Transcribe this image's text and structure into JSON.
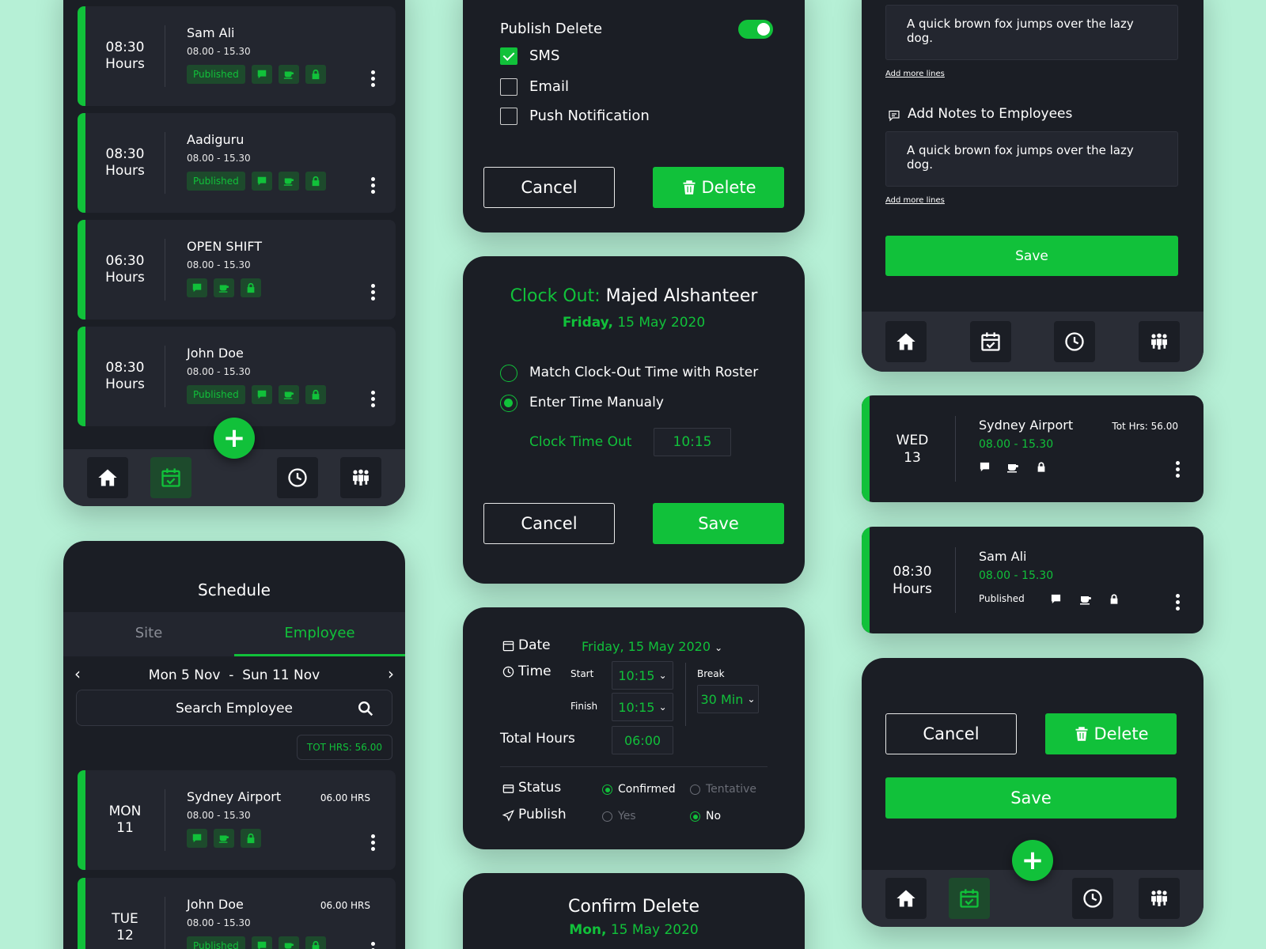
{
  "colors": {
    "accent": "#11c13a",
    "panel": "#1b1e25",
    "card": "#23262f",
    "background": "#b6f0d6"
  },
  "icons": [
    "chat-icon",
    "coffee-icon",
    "lock-icon",
    "home-icon",
    "calendar-check-icon",
    "clock-icon",
    "team-icon",
    "trash-icon",
    "search-icon",
    "calendar-icon",
    "status-icon",
    "send-icon",
    "note-icon",
    "plus-icon",
    "chevron-down-icon"
  ],
  "roster": {
    "shifts": [
      {
        "hours_value": "08:30",
        "hours_label": "Hours",
        "name": "Sam Ali",
        "time": "08.00 - 15.30",
        "badge": "Published"
      },
      {
        "hours_value": "08:30",
        "hours_label": "Hours",
        "name": "Aadiguru",
        "time": "08.00 - 15.30",
        "badge": "Published"
      },
      {
        "hours_value": "06:30",
        "hours_label": "Hours",
        "name": "OPEN SHIFT",
        "time": "08.00 - 15.30",
        "badge": ""
      },
      {
        "hours_value": "08:30",
        "hours_label": "Hours",
        "name": "John Doe",
        "time": "08.00 - 15.30",
        "badge": "Published"
      }
    ],
    "fab": "+"
  },
  "schedule": {
    "title": "Schedule",
    "tabs": [
      "Site",
      "Employee"
    ],
    "active_tab": "Employee",
    "range_start": "Mon 5 Nov",
    "range_sep": "-",
    "range_end": "Sun 11 Nov",
    "prev": "‹",
    "next": "›",
    "search_placeholder": "Search Employee",
    "total_hours": "TOT HRS: 56.00",
    "days": [
      {
        "day": "MON",
        "date": "11",
        "name": "Sydney Airport",
        "time": "08.00 - 15.30",
        "hours": "06.00 HRS",
        "badge": ""
      },
      {
        "day": "TUE",
        "date": "12",
        "name": "John Doe",
        "time": "08.00 - 15.30",
        "hours": "06.00 HRS",
        "badge": "Published"
      }
    ]
  },
  "publish_delete": {
    "title": "Publish Delete",
    "toggle_on": true,
    "options": [
      {
        "label": "SMS",
        "checked": true
      },
      {
        "label": "Email",
        "checked": false
      },
      {
        "label": "Push Notification",
        "checked": false
      }
    ],
    "cancel_label": "Cancel",
    "delete_label": "Delete"
  },
  "clock_out": {
    "title_prefix": "Clock Out:",
    "employee": "Majed Alshanteer",
    "date_day": "Friday,",
    "date_rest": "15 May 2020",
    "options": [
      {
        "label": "Match Clock-Out Time with Roster",
        "selected": false
      },
      {
        "label": "Enter Time Manualy",
        "selected": true
      }
    ],
    "time_out_label": "Clock Time Out",
    "time_out_value": "10:15",
    "cancel_label": "Cancel",
    "save_label": "Save"
  },
  "shift_form": {
    "date_label": "Date",
    "date_value": "Friday, 15 May 2020",
    "time_label": "Time",
    "start_label": "Start",
    "start_value": "10:15",
    "finish_label": "Finish",
    "finish_value": "10:15",
    "break_label": "Break",
    "break_value": "30 Min",
    "total_label": "Total Hours",
    "total_value": "06:00",
    "status_label": "Status",
    "status_options": [
      {
        "label": "Confirmed",
        "selected": true
      },
      {
        "label": "Tentative",
        "selected": false
      }
    ],
    "publish_label": "Publish",
    "publish_options": [
      {
        "label": "Yes",
        "selected": false
      },
      {
        "label": "No",
        "selected": true
      }
    ]
  },
  "confirm_delete": {
    "title": "Confirm Delete",
    "date_day": "Mon,",
    "date_rest": "15 May 2020"
  },
  "notes": {
    "note_text_1": "A quick brown fox jumps over the lazy dog.",
    "add_more_1": "Add more lines",
    "section_title": "Add Notes to Employees",
    "note_text_2": "A quick brown fox jumps over the lazy dog.",
    "add_more_2": "Add more lines",
    "save_label": "Save"
  },
  "site_card": {
    "day": "WED",
    "date": "13",
    "name": "Sydney Airport",
    "time": "08.00 - 15.30",
    "total": "Tot Hrs: 56.00"
  },
  "emp_card": {
    "hours_value": "08:30",
    "hours_label": "Hours",
    "name": "Sam Ali",
    "time": "08.00 - 15.30",
    "badge": "Published"
  },
  "action_panel": {
    "cancel_label": "Cancel",
    "delete_label": "Delete",
    "save_label": "Save",
    "fab": "+"
  }
}
